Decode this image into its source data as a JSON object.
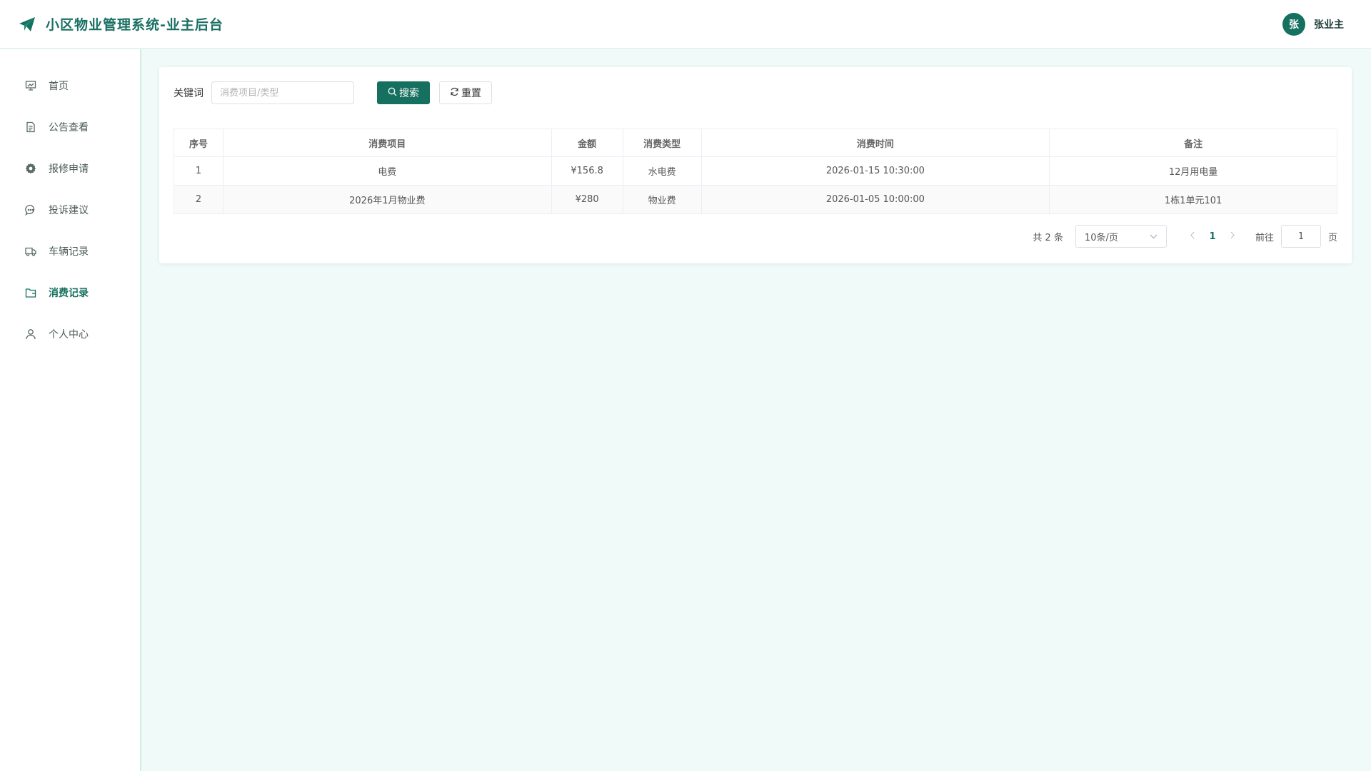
{
  "header": {
    "title": "小区物业管理系统-业主后台",
    "avatar_text": "张",
    "user_name": "张业主"
  },
  "sidebar": {
    "items": [
      {
        "label": "首页",
        "icon": "presentation-chart-icon",
        "active": false
      },
      {
        "label": "公告查看",
        "icon": "document-icon",
        "active": false
      },
      {
        "label": "报修申请",
        "icon": "gear-icon",
        "active": false
      },
      {
        "label": "投诉建议",
        "icon": "chat-bubble-icon",
        "active": false
      },
      {
        "label": "车辆记录",
        "icon": "truck-icon",
        "active": false
      },
      {
        "label": "消费记录",
        "icon": "wallet-icon",
        "active": true
      },
      {
        "label": "个人中心",
        "icon": "user-icon",
        "active": false
      }
    ]
  },
  "search": {
    "label": "关键词",
    "placeholder": "消费项目/类型",
    "value": "",
    "search_label": "搜索",
    "reset_label": "重置"
  },
  "table": {
    "columns": [
      "序号",
      "消费项目",
      "金额",
      "消费类型",
      "消费时间",
      "备注"
    ],
    "rows": [
      [
        "1",
        "电费",
        "¥156.8",
        "水电费",
        "2026-01-15 10:30:00",
        "12月用电量"
      ],
      [
        "2",
        "2026年1月物业费",
        "¥280",
        "物业费",
        "2026-01-05 10:00:00",
        "1栋1单元101"
      ]
    ]
  },
  "pagination": {
    "total_text": "共 2 条",
    "page_size": "10条/页",
    "current_page": "1",
    "goto_label": "前往",
    "goto_value": "1",
    "page_suffix": "页"
  },
  "colors": {
    "accent": "#16705f",
    "background": "#f0faf8"
  }
}
